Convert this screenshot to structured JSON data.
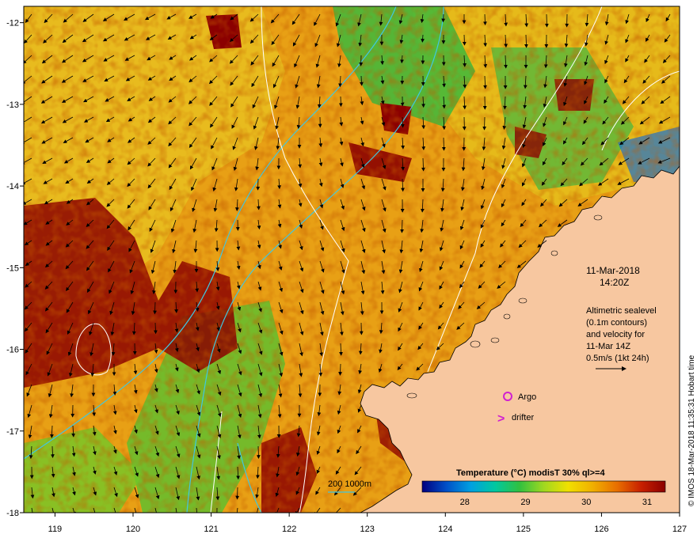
{
  "map": {
    "lon_ticks": [
      "119",
      "120",
      "121",
      "122",
      "123",
      "124",
      "125",
      "126",
      "127"
    ],
    "lat_ticks": [
      "-12",
      "-13",
      "-14",
      "-15",
      "-16",
      "-17",
      "-18"
    ],
    "lon_range": [
      118.6,
      127.0
    ],
    "lat_range": [
      -18.0,
      -11.8
    ]
  },
  "annotations": {
    "date": "11-Mar-2018",
    "time": "14:20Z",
    "alt_lines": [
      "Altimetric sealevel",
      "(0.1m contours)",
      "and velocity for",
      "11-Mar 14Z",
      "0.5m/s (1kt 24h)"
    ],
    "argo_label": "Argo",
    "drifter_label": "drifter",
    "drifter_symbol": ">",
    "isobath_label": "200  1000m"
  },
  "colorbar": {
    "title": "Temperature  (°C) modisT 30% ql>=4",
    "ticks": [
      "28",
      "29",
      "30",
      "31"
    ],
    "range": [
      27.3,
      31.3
    ],
    "colors": [
      "#00007f",
      "#0050c8",
      "#00a0e0",
      "#00c8a0",
      "#30c040",
      "#a0d820",
      "#f0e000",
      "#f0b000",
      "#e87000",
      "#c82000",
      "#8b0000"
    ]
  },
  "credit": "© IMOS 18-Mar-2018 11:35:31 Hobart time",
  "colors": {
    "land": "#f7c7a0",
    "hot": "#8b0000",
    "warm": "#e8a010",
    "isobath": "#40c8e0",
    "contour": "#ffffff",
    "argo": "#d020d0"
  }
}
